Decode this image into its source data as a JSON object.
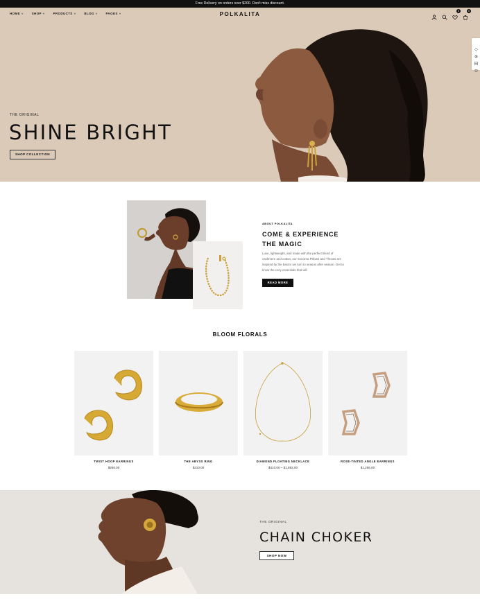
{
  "announcement": "Free Delivery on orders over $200. Don't miss discount.",
  "header": {
    "logo": "POLKALITA",
    "nav": [
      {
        "label": "HOME",
        "chev": "˅"
      },
      {
        "label": "SHOP",
        "chev": "˅"
      },
      {
        "label": "PRODUCTS",
        "chev": "˅"
      },
      {
        "label": "BLOG",
        "chev": "˅"
      },
      {
        "label": "PAGES",
        "chev": "˅"
      }
    ],
    "icons": [
      "user-icon",
      "search-icon",
      "wishlist-icon",
      "cart-icon"
    ],
    "wishlist_count": "0",
    "cart_count": "0"
  },
  "side_widget": {
    "icons": [
      "theme-icon",
      "settings-icon",
      "layout-icon",
      "cart-icon"
    ]
  },
  "hero": {
    "eyebrow": "THE ORIGINAL",
    "title": "SHINE BRIGHT",
    "button": "SHOP COLLECTION",
    "bg_color": "#dccab8"
  },
  "about": {
    "eyebrow": "ABOUT POLKALITA",
    "title_line1": "COME & EXPERIENCE",
    "title_line2": "THE MAGIC",
    "text": "Luxe, lightweight, and made with the perfect blend of cashmere and cotton, our Sonoma Pillows and Throws are inspired by the basics we turn to season after season. Get to know the cozy essentials that will",
    "button": "READ MORE"
  },
  "collection": {
    "title": "BLOOM FLORALS",
    "products": [
      {
        "name": "TWIST HOOP EARRINGS",
        "price": "$256.00"
      },
      {
        "name": "THE ABYSS RING",
        "price": "$210.00"
      },
      {
        "name": "DIAMOND FLOATING NECKLACE",
        "price": "$410.00 – $1,892.00"
      },
      {
        "name": "ROSE-TINTED ANGLE EARRINGS",
        "price": "$1,256.00"
      }
    ]
  },
  "banner": {
    "eyebrow": "THE ORIGINAL",
    "title": "CHAIN CHOKER",
    "button": "SHOP NOW"
  }
}
